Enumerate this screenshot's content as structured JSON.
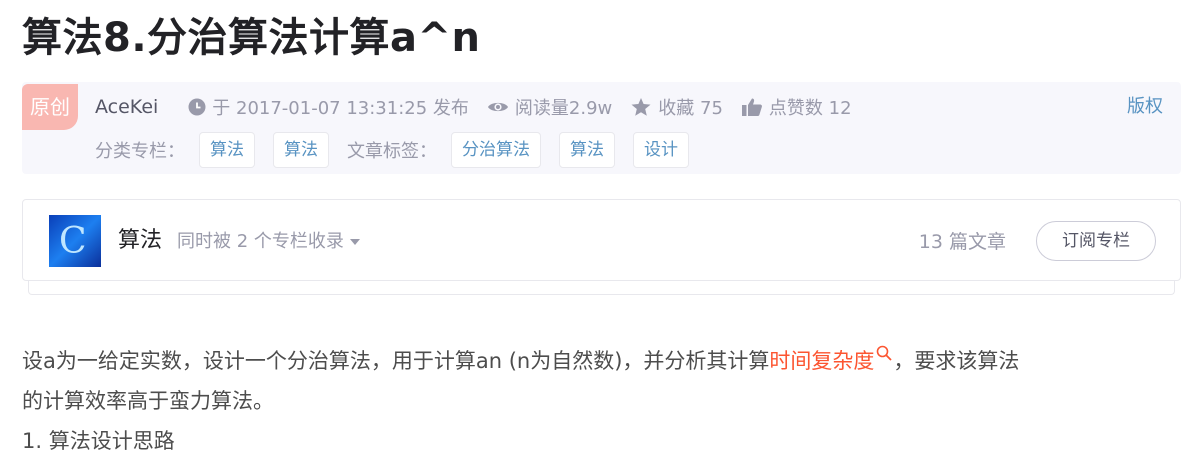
{
  "article": {
    "title": "算法8.分治算法计算a^n"
  },
  "meta": {
    "original_badge": "原创",
    "author": "AceKei",
    "published": "于 2017-01-07 13:31:25 发布",
    "reads": "阅读量2.9w",
    "favorites": "收藏 75",
    "likes": "点赞数 12",
    "copyright": "版权",
    "category_label": "分类专栏：",
    "categories": [
      "算法",
      "算法"
    ],
    "tags_label": "文章标签：",
    "tags": [
      "分治算法",
      "算法",
      "设计"
    ]
  },
  "column": {
    "thumb_glyph": "C",
    "name": "算法",
    "included": "同时被 2 个专栏收录",
    "count": "13 篇文章",
    "subscribe": "订阅专栏"
  },
  "content": {
    "p1_before": "设a为一给定实数，设计一个分治算法，用于计算an (n为自然数)，并分析其计算",
    "p1_link": "时间复杂度",
    "p1_after": "，要求该算法",
    "p2": "的计算效率高于蛮力算法。",
    "p3": "1. 算法设计思路"
  },
  "colors": {
    "accent_link": "#fc5531",
    "tag_text": "#5893c2",
    "original_badge": "#f9b7b1"
  }
}
